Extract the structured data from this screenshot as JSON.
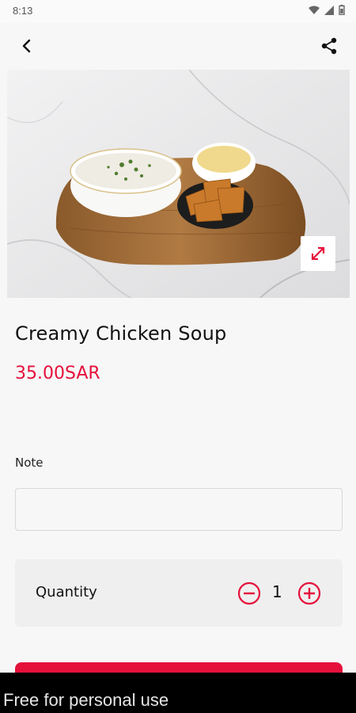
{
  "status_bar": {
    "time": "8:13"
  },
  "header": {
    "back_icon": "chevron-left-icon",
    "share_icon": "share-icon"
  },
  "product": {
    "title": "Creamy Chicken Soup",
    "price": "35.00SAR"
  },
  "note": {
    "label": "Note",
    "value": "",
    "placeholder": ""
  },
  "quantity": {
    "label": "Quantity",
    "value": "1"
  },
  "colors": {
    "accent": "#e5113b",
    "background": "#f7f7f7",
    "card": "#efefef"
  },
  "watermark": {
    "text": "Free for personal use"
  }
}
